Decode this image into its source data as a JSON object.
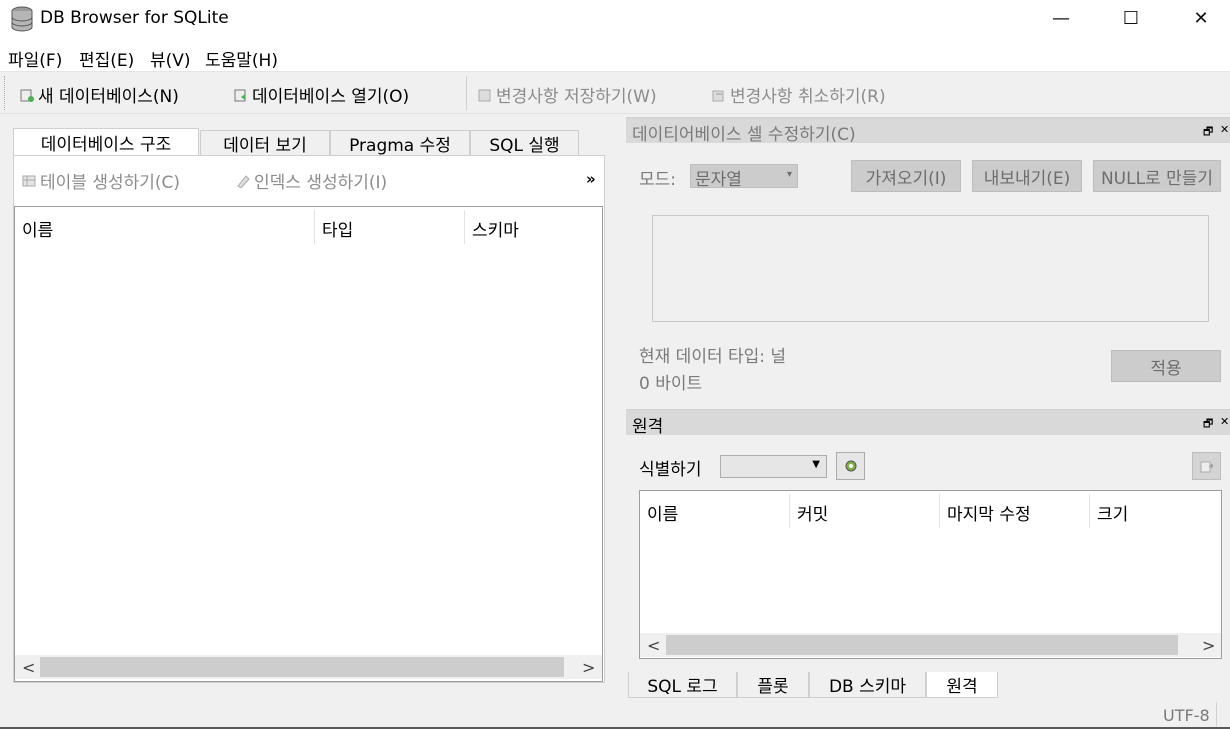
{
  "window": {
    "title": "DB Browser for SQLite",
    "minimize": "—",
    "maximize": "☐",
    "close": "✕"
  },
  "menu": [
    "파일(F)",
    "편집(E)",
    "뷰(V)",
    "도움말(H)"
  ],
  "toolbar": {
    "new_db": "새 데이터베이스(N)",
    "open_db": "데이터베이스 열기(O)",
    "write_changes": "변경사항 저장하기(W)",
    "revert_changes": "변경사항 취소하기(R)"
  },
  "main_tabs": [
    "데이터베이스 구조",
    "데이터 보기",
    "Pragma 수정",
    "SQL 실행"
  ],
  "structure": {
    "create_table": "테이블 생성하기(C)",
    "create_index": "인덱스 생성하기(I)",
    "more": "»",
    "columns": [
      "이름",
      "타입",
      "스키마"
    ]
  },
  "edit_cell": {
    "title": "데이티어베이스 셀 수정하기(C)",
    "mode_label": "모드:",
    "mode_value": "문자열",
    "import": "가져오기(I)",
    "export": "내보내기(E)",
    "set_null": "NULL로 만들기",
    "type_info": "현재 데이터 타입: 널",
    "size_info": "0 바이트",
    "apply": "적용"
  },
  "remote": {
    "title": "원격",
    "identity_label": "식별하기",
    "columns": [
      "이름",
      "커밋",
      "마지막 수정",
      "크기"
    ]
  },
  "bottom_tabs": [
    "SQL 로그",
    "플롯",
    "DB 스키마",
    "원격"
  ],
  "status": {
    "encoding": "UTF-8"
  }
}
